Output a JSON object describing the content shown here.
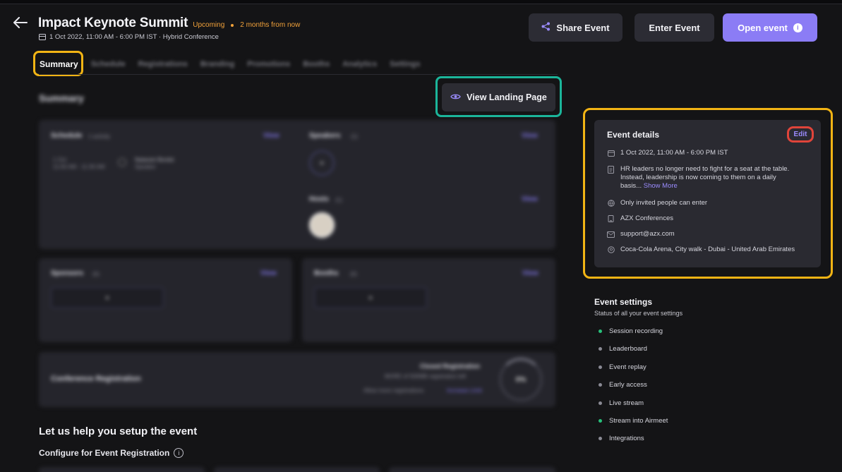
{
  "header": {
    "title": "Impact Keynote Summit",
    "status": "Upcoming",
    "relative_time": "2 months from now",
    "subtitle": "1 Oct 2022, 11:00 AM - 6:00 PM IST · Hybrid Conference"
  },
  "actions": {
    "share_label": "Share Event",
    "enter_label": "Enter Event",
    "open_label": "Open event",
    "open_info_glyph": "i"
  },
  "tabs": [
    {
      "label": "Summary",
      "active": true
    },
    {
      "label": "Schedule"
    },
    {
      "label": "Registrations"
    },
    {
      "label": "Branding"
    },
    {
      "label": "Promotions"
    },
    {
      "label": "Booths"
    },
    {
      "label": "Analytics"
    },
    {
      "label": "Settings"
    }
  ],
  "summary": {
    "heading": "Summary",
    "view_landing_label": "View Landing Page",
    "schedule_card": {
      "label": "Schedule",
      "count": "1 activity",
      "view": "View",
      "line1": "1 Oct",
      "line2": "11:00 AM - 11:30 AM",
      "speaker": "Natarani Bordoi",
      "speaker_role": "Speaker"
    },
    "speakers_card": {
      "label": "Speakers",
      "count": "(1)",
      "view": "View",
      "placeholder": "+"
    },
    "hosts_card": {
      "label": "Hosts",
      "count": "(1)",
      "view": "View"
    },
    "sponsors_card": {
      "label": "Sponsors",
      "count": "(0)",
      "view": "View",
      "placeholder": "+"
    },
    "booths_card": {
      "label": "Booths",
      "count": "(0)",
      "view": "View",
      "placeholder": "+"
    },
    "registration_card": {
      "label": "Conference Registration",
      "right_title": "Closed Registration",
      "right_line": "MORE of 500MB registration left",
      "right_line2": "Allow more registrations",
      "right_link": "Increase Limit",
      "percent": "0%"
    }
  },
  "setup": {
    "heading": "Let us help you setup the event",
    "subheading": "Configure for Event Registration",
    "info_glyph": "i"
  },
  "event_details": {
    "title": "Event details",
    "edit_label": "Edit",
    "datetime": "1 Oct 2022, 11:00 AM - 6:00 PM IST",
    "description_line1": "HR leaders no longer need to fight for a seat at the table.",
    "description_line2": "Instead, leadership is now coming to them on a daily",
    "description_line3": "basis...",
    "show_more": "Show More",
    "access": "Only invited people can enter",
    "organizer": "AZX Conferences",
    "email": "support@azx.com",
    "location": "Coca-Cola Arena, City walk - Dubai - United Arab Emirates"
  },
  "event_settings": {
    "title": "Event settings",
    "subtitle": "Status of all your event settings",
    "items": [
      {
        "label": "Session recording",
        "color": "#27c07a"
      },
      {
        "label": "Leaderboard",
        "color": "#8a8a94"
      },
      {
        "label": "Event replay",
        "color": "#8a8a94"
      },
      {
        "label": "Early access",
        "color": "#8a8a94"
      },
      {
        "label": "Live stream",
        "color": "#8a8a94"
      },
      {
        "label": "Stream into Airmeet",
        "color": "#27c07a"
      },
      {
        "label": "Integrations",
        "color": "#8a8a94"
      }
    ]
  },
  "colors": {
    "accent": "#8b7cf5",
    "highlight_yellow": "#f2b414",
    "highlight_teal": "#1bb59a",
    "highlight_red": "#e0443a",
    "status_orange": "#f2a23a"
  }
}
